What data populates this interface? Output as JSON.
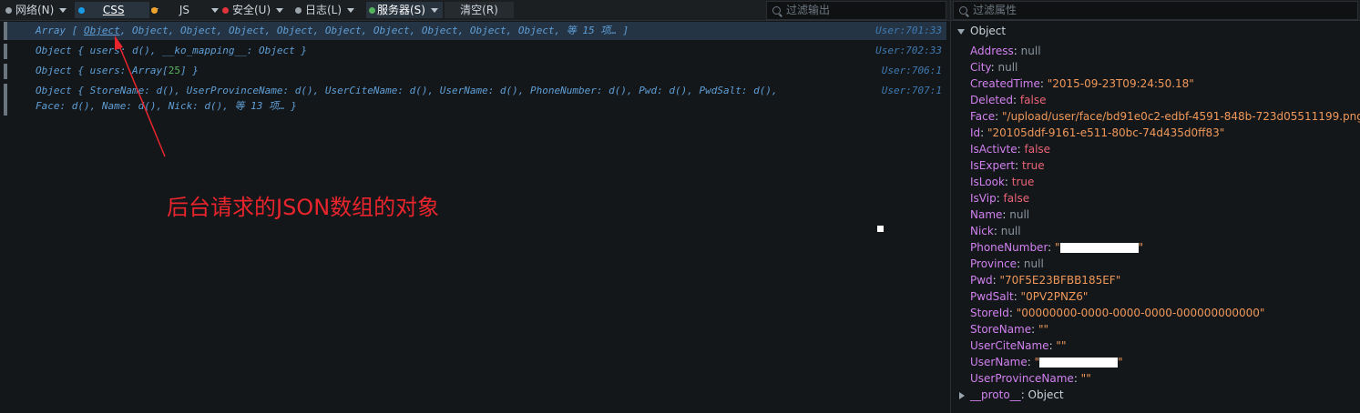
{
  "toolbar": {
    "network_label": "网络(N)",
    "css_label": "CSS",
    "js_label": "JS",
    "security_label": "安全(U)",
    "log_label": "日志(L)",
    "server_label": "服务器(S)",
    "clear_label": "清空(R)",
    "filter_output_placeholder": "过滤输出",
    "filter_props_placeholder": "过滤属性",
    "colors": {
      "net": "#9aa4ac",
      "css": "#1a9be6",
      "js": "#f0a22b",
      "security": "#e0343c",
      "log": "#9aa4ac",
      "server": "#55b25d"
    }
  },
  "console": {
    "rows": [
      {
        "prefix": "Array [ ",
        "link": "Object",
        "rest": ", Object, Object, Object, Object, Object, Object, Object, Object, Object, 等 15 项… ]",
        "location": "User:701:33"
      },
      {
        "text": "Object { users: d(), __ko_mapping__: Object }",
        "location": "User:702:33"
      },
      {
        "prefix": "Object { users: Array[",
        "num": "25",
        "rest": "] }",
        "location": "User:706:1"
      },
      {
        "line1": "Object { StoreName: d(), UserProvinceName: d(), UserCiteName: d(), UserName: d(), PhoneNumber: d(), Pwd: d(), PwdSalt: d(),",
        "line2": "Face: d(), Name: d(), Nick: d(), 等 13 项… }",
        "location": "User:707:1"
      }
    ],
    "annotation": "后台请求的JSON数组的对象"
  },
  "inspector": {
    "root_label": "Object",
    "properties": [
      {
        "key": "Address",
        "value": "null",
        "type": "null"
      },
      {
        "key": "City",
        "value": "null",
        "type": "null"
      },
      {
        "key": "CreatedTime",
        "value": "\"2015-09-23T09:24:50.18\"",
        "type": "str"
      },
      {
        "key": "Deleted",
        "value": "false",
        "type": "bool"
      },
      {
        "key": "Face",
        "value": "\"/upload/user/face/bd91e0c2-edbf-4591-848b-723d05511199.png\"",
        "type": "str"
      },
      {
        "key": "Id",
        "value": "\"20105ddf-9161-e511-80bc-74d435d0ff83\"",
        "type": "str"
      },
      {
        "key": "IsActivte",
        "value": "false",
        "type": "bool"
      },
      {
        "key": "IsExpert",
        "value": "true",
        "type": "bool"
      },
      {
        "key": "IsLook",
        "value": "true",
        "type": "bool"
      },
      {
        "key": "IsVip",
        "value": "false",
        "type": "bool"
      },
      {
        "key": "Name",
        "value": "null",
        "type": "null"
      },
      {
        "key": "Nick",
        "value": "null",
        "type": "null"
      },
      {
        "key": "PhoneNumber",
        "value": "\"",
        "value_after": "\"",
        "type": "redacted"
      },
      {
        "key": "Province",
        "value": "null",
        "type": "null"
      },
      {
        "key": "Pwd",
        "value": "\"70F5E23BFBB185EF\"",
        "type": "str"
      },
      {
        "key": "PwdSalt",
        "value": "\"0PV2PNZ6\"",
        "type": "str"
      },
      {
        "key": "StoreId",
        "value": "\"00000000-0000-0000-0000-000000000000\"",
        "type": "str"
      },
      {
        "key": "StoreName",
        "value": "\"\"",
        "type": "str"
      },
      {
        "key": "UserCiteName",
        "value": "\"\"",
        "type": "str"
      },
      {
        "key": "UserName",
        "value": "\"",
        "value_after": "\"",
        "type": "redacted"
      },
      {
        "key": "UserProvinceName",
        "value": "\"\"",
        "type": "str"
      }
    ],
    "proto": {
      "key": "__proto__",
      "value": "Object"
    }
  }
}
